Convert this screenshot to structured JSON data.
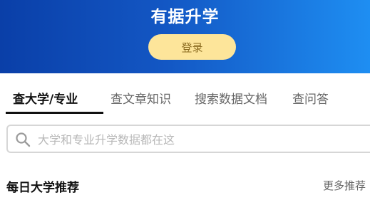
{
  "header": {
    "title": "有据升学",
    "login_label": "登录"
  },
  "tabs": [
    {
      "label": "查大学/专业",
      "active": true
    },
    {
      "label": "查文章知识",
      "active": false
    },
    {
      "label": "搜索数据文档",
      "active": false
    },
    {
      "label": "查问答",
      "active": false
    }
  ],
  "search": {
    "placeholder": "大学和专业升学数据都在这",
    "value": "",
    "icon": "search-icon"
  },
  "section": {
    "title": "每日大学推荐",
    "more_label": "更多推荐"
  },
  "colors": {
    "header_gradient_start": "#0a3fa8",
    "header_gradient_end": "#1e8ef2",
    "login_button_bg": "#fde59a",
    "login_button_text": "#8a6a1f",
    "active_tab": "#111111",
    "inactive_tab": "#666666"
  }
}
